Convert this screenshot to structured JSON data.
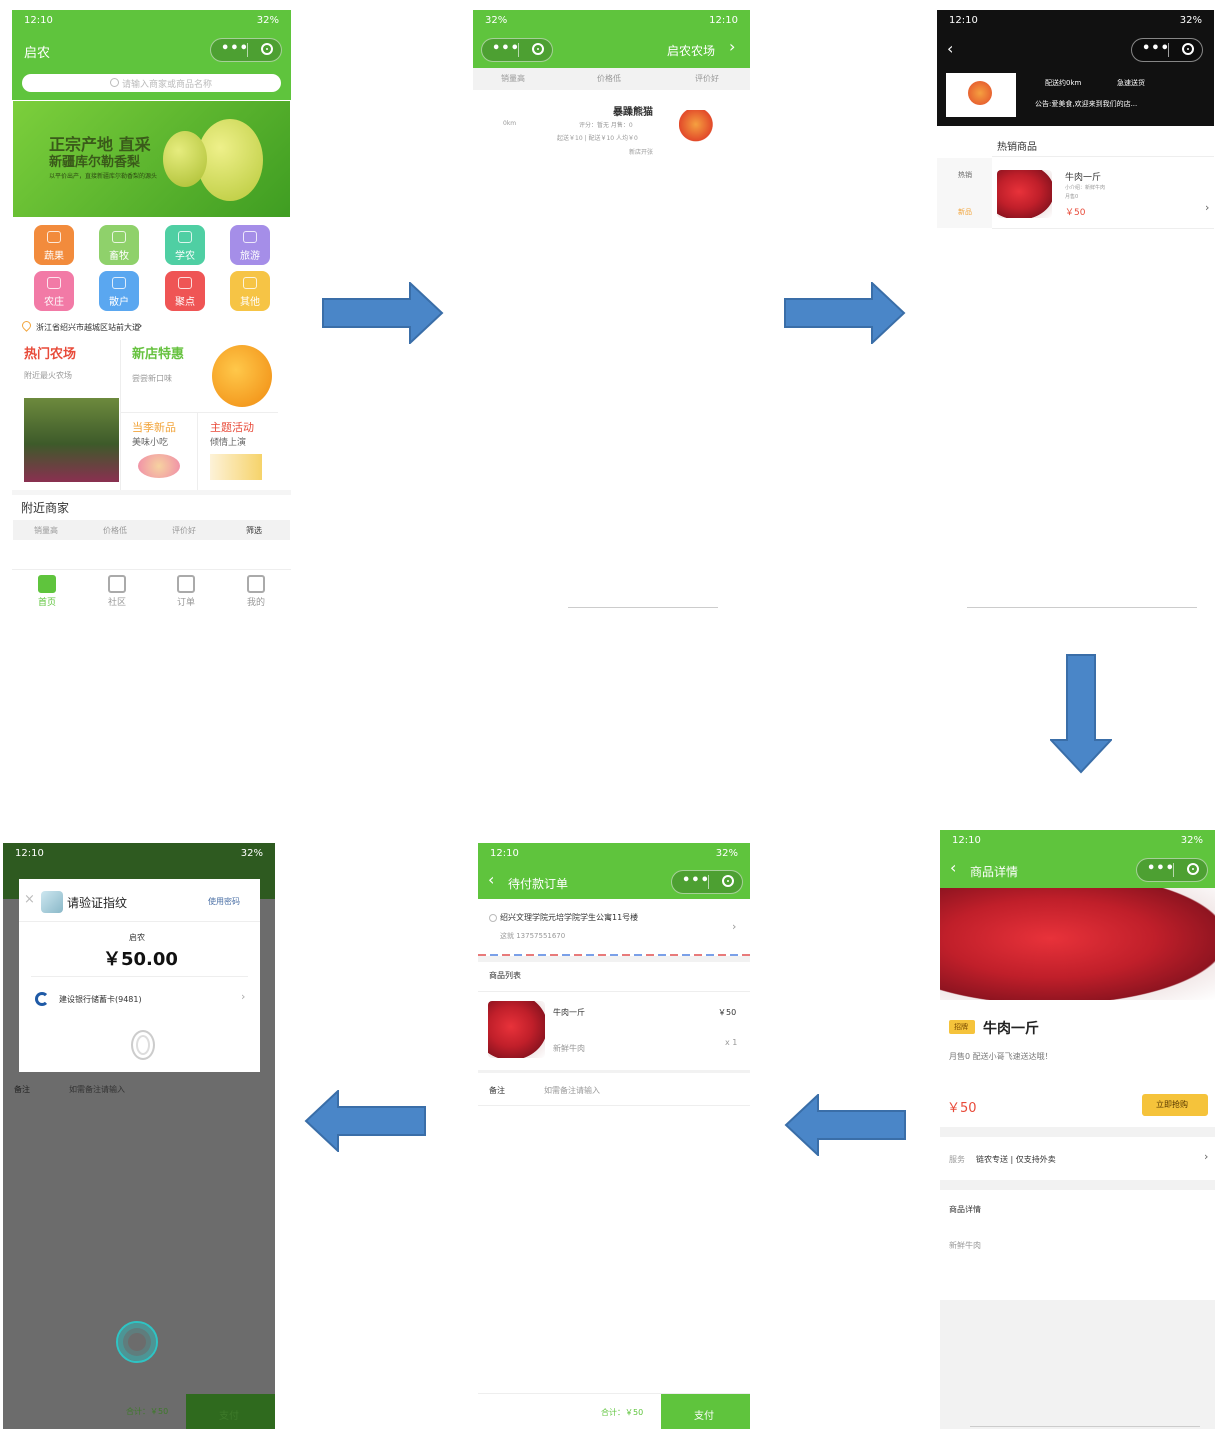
{
  "colors": {
    "brand_green": "#5fc43d",
    "price_red": "#e84b3a",
    "button_yellow": "#f5c33b",
    "arrow_blue": "#4a86c8"
  },
  "status_bar": {
    "time": "12:10",
    "battery": "32%"
  },
  "screen1": {
    "title": "启农",
    "search_placeholder": "请输入商家或商品名称",
    "banner_line1": "正宗产地 直采",
    "banner_line2": "新疆库尔勒香梨",
    "banner_line3": "以平价出产，直接新疆库尔勒香梨的源头",
    "categories": [
      {
        "label": "蔬果",
        "color": "#f28b3c"
      },
      {
        "label": "畜牧",
        "color": "#8fd16b"
      },
      {
        "label": "学农",
        "color": "#4fcfa3"
      },
      {
        "label": "旅游",
        "color": "#a58ee8"
      },
      {
        "label": "农庄",
        "color": "#f27aa6"
      },
      {
        "label": "散户",
        "color": "#5aa7f0"
      },
      {
        "label": "聚点",
        "color": "#ef5555"
      },
      {
        "label": "其他",
        "color": "#f6c445"
      }
    ],
    "location": "浙江省绍兴市越城区站前大道",
    "hot_farm_title": "热门农场",
    "hot_farm_sub": "附近最火农场",
    "new_shop_title": "新店特惠",
    "new_shop_sub": "尝尝新口味",
    "season_title": "当季新品",
    "season_sub": "美味小吃",
    "theme_title": "主题活动",
    "theme_sub": "倾情上演",
    "nearby_title": "附近商家",
    "filters": [
      "销量高",
      "价格低",
      "评价好",
      "筛选"
    ],
    "tabs": [
      "首页",
      "社区",
      "订单",
      "我的"
    ]
  },
  "screen2": {
    "title": "启农农场",
    "filters": [
      "销量高",
      "价格低",
      "评价好"
    ],
    "shop_name": "暴躁熊猫",
    "shop_line1": "评分：暂无  月售：0",
    "shop_line2": "起送￥10 | 配送￥10  人均￥0",
    "shop_distance": "0km",
    "shop_tag": "新店开张"
  },
  "screen3": {
    "delivery_info": "配送约0km",
    "speed_info": "急速送货",
    "notice": "公告:爱美食,欢迎来到我们的店...",
    "section_title": "热销商品",
    "side_tabs": [
      "热销",
      "新品"
    ],
    "product_name": "牛肉一斤",
    "product_meta1": "小介绍：新鲜牛肉",
    "product_meta2": "月售0",
    "product_price": "￥50"
  },
  "screen4": {
    "nav_title": "商品详情",
    "tag": "招牌",
    "product_name": "牛肉一斤",
    "sales": "月售0   配送小哥飞速送达哦！",
    "price": "￥50",
    "buy_button": "立即抢购",
    "service_label": "服务",
    "service_value": "链农专送  |  仅支持外卖",
    "detail_title": "商品详情",
    "detail_text": "新鲜牛肉"
  },
  "screen5": {
    "nav_title": "待付款订单",
    "address": "绍兴文理学院元培学院学生公寓11号楼",
    "contact": "这就 13757551670",
    "list_title": "商品列表",
    "item_name": "牛肉一斤",
    "item_desc": "新鲜牛肉",
    "item_price": "￥50",
    "item_qty": "x 1",
    "remark_label": "备注",
    "remark_placeholder": "如需备注请输入",
    "total": "合计：￥50",
    "pay_button": "支付"
  },
  "screen6": {
    "dialog_title": "请验证指纹",
    "use_password": "使用密码",
    "merchant": "启农",
    "amount": "￥50.00",
    "card": "建设银行储蓄卡(9481)",
    "remark_label": "备注",
    "remark_placeholder": "如需备注请输入",
    "total": "合计：￥50",
    "pay_button": "支付"
  }
}
